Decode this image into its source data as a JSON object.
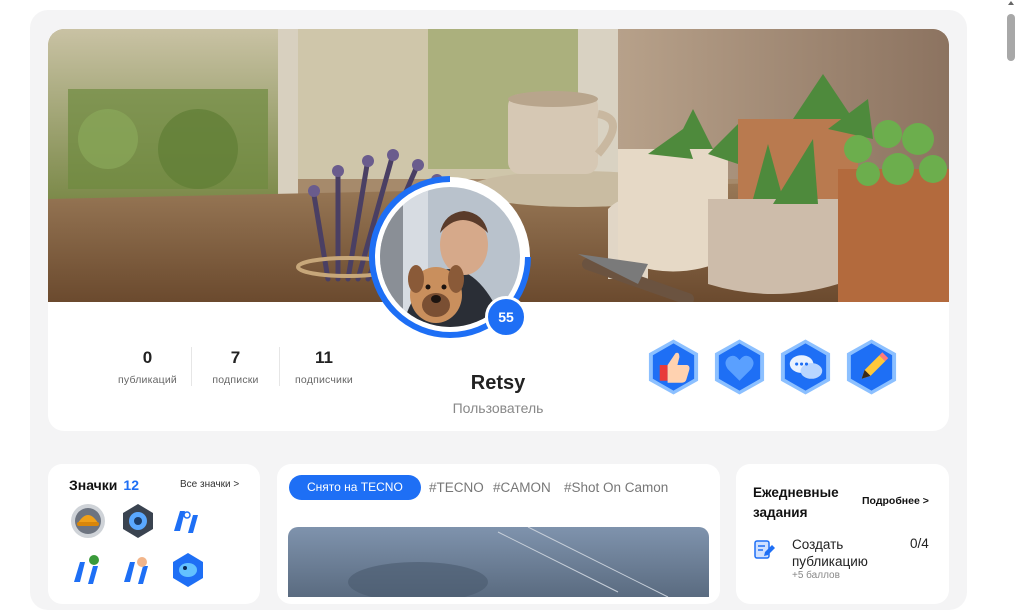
{
  "profile": {
    "username": "Retsy",
    "role": "Пользователь",
    "level": "55",
    "stats": [
      {
        "value": "0",
        "label": "публикаций"
      },
      {
        "value": "7",
        "label": "подписки"
      },
      {
        "value": "11",
        "label": "подписчики"
      }
    ],
    "achievements": [
      {
        "icon": "thumbs-up-icon"
      },
      {
        "icon": "heart-icon"
      },
      {
        "icon": "chat-bubbles-icon"
      },
      {
        "icon": "pencil-icon"
      }
    ]
  },
  "badges": {
    "title": "Значки",
    "count": "12",
    "all_link": "Все значки >"
  },
  "feed": {
    "active_tag": "Снято на TECNO",
    "tags": [
      "#TECNO",
      "#CAMON",
      "#Shot On Camon"
    ]
  },
  "tasks": {
    "title": "Ежедневные задания",
    "more_link": "Подробнее >",
    "items": [
      {
        "label": "Создать публикацию",
        "progress": "0/4",
        "reward": "+5 баллов"
      }
    ]
  },
  "colors": {
    "accent": "#1e6ff5",
    "page_bg": "#f4f4f5"
  }
}
